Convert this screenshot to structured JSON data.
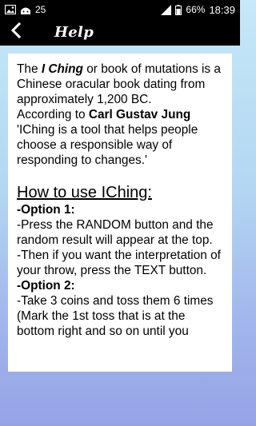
{
  "status_bar": {
    "signal_value": "25",
    "battery_percent": "66%",
    "time": "18:39"
  },
  "header": {
    "title": "Help",
    "back_icon": "chevron-left-icon"
  },
  "help": {
    "intro_p1": "The",
    "intro_p2": "I Ching",
    "intro_p3": "or book of mutations is a Chinese oracular book dating from approximately 1,200 BC.",
    "jung_p1": "According to",
    "jung_name": "Carl Gustav Jung",
    "jung_quote": "'IChing is a tool that helps people choose a responsible way of responding to changes.'",
    "how_to_title": "How to use IChing:",
    "option1_label": "-Option 1:",
    "option1_step1": "-Press the RANDOM button and the random result will appear at the top.",
    "option1_step2": "-Then if you want the interpretation of your throw, press the TEXT button.",
    "option2_label": "-Option 2:",
    "option2_step1": "-Take 3 coins and toss them 6 times (Mark the 1st toss that is at the bottom right and so on until you"
  }
}
